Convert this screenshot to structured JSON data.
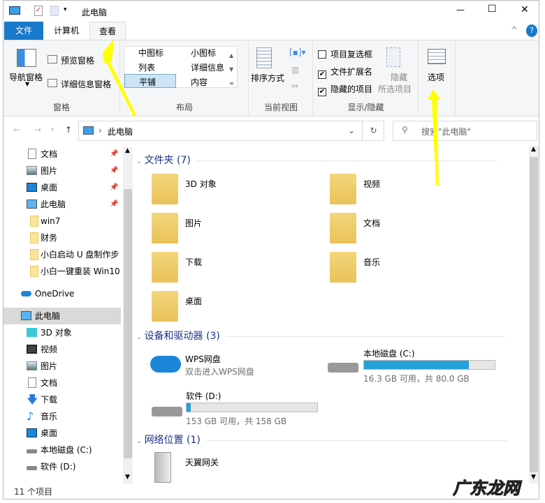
{
  "window": {
    "title": "此电脑",
    "minimize": "—",
    "maximize": "☐",
    "close": "✕"
  },
  "tabs": {
    "file": "文件",
    "computer": "计算机",
    "view": "查看"
  },
  "ribbon": {
    "panes": {
      "nav_pane": "导航窗格",
      "preview_pane": "预览窗格",
      "details_pane": "详细信息窗格",
      "group": "窗格"
    },
    "layout": {
      "medium_icons": "中图标",
      "small_icons": "小图标",
      "list": "列表",
      "details": "详细信息",
      "tiles": "平铺",
      "content": "内容",
      "group": "布局"
    },
    "current_view": {
      "sort_by": "排序方式",
      "group": "当前视图"
    },
    "show_hide": {
      "item_checkboxes": "项目复选框",
      "item_checkboxes_checked": false,
      "file_extensions": "文件扩展名",
      "file_extensions_checked": true,
      "hidden_items": "隐藏的项目",
      "hidden_items_checked": true,
      "hide_selected_1": "隐藏",
      "hide_selected_2": "所选项目",
      "group": "显示/隐藏"
    },
    "options": "选项"
  },
  "address": {
    "path": "此电脑",
    "search_placeholder": "搜索\"此电脑\""
  },
  "nav": {
    "quick": [
      {
        "label": "文档",
        "icon": "document-icon"
      },
      {
        "label": "图片",
        "icon": "pictures-icon"
      },
      {
        "label": "桌面",
        "icon": "desktop-icon"
      },
      {
        "label": "此电脑",
        "icon": "computer-icon"
      }
    ],
    "folders": [
      "win7",
      "财务",
      "小白启动 U 盘制作步",
      "小白一键重装 Win10"
    ],
    "onedrive": "OneDrive",
    "this_pc": "此电脑",
    "pc_items": [
      "3D 对象",
      "视频",
      "图片",
      "文档",
      "下载",
      "音乐",
      "桌面",
      "本地磁盘 (C:)",
      "软件 (D:)"
    ]
  },
  "main": {
    "folders_header": "文件夹 (7)",
    "folders": [
      "3D 对象",
      "视频",
      "图片",
      "文档",
      "下载",
      "音乐",
      "桌面"
    ],
    "devices_header": "设备和驱动器 (3)",
    "wps": {
      "name": "WPS网盘",
      "sub": "双击进入WPS网盘"
    },
    "drive_c": {
      "name": "本地磁盘 (C:)",
      "free": "16.3 GB 可用，共 80.0 GB",
      "used_fraction": 0.8
    },
    "drive_d": {
      "name": "软件 (D:)",
      "free": "153 GB 可用，共 158 GB",
      "used_fraction": 0.03
    },
    "network_header": "网络位置 (1)",
    "network": [
      "天翼网关"
    ]
  },
  "status": "11 个项目",
  "watermark": "广东龙网",
  "colors": {
    "accent": "#1979ca",
    "annotation": "#ffff00"
  }
}
